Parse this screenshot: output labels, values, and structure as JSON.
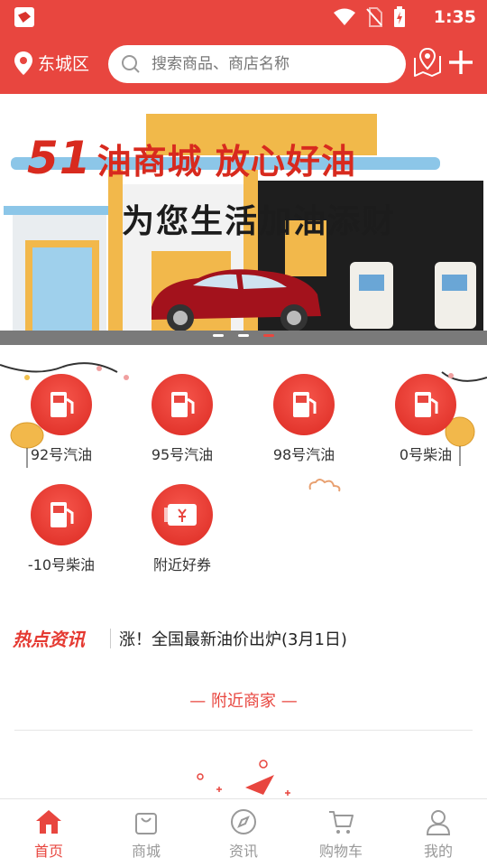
{
  "status_bar": {
    "time": "1:35"
  },
  "header": {
    "location": "东城区",
    "search_placeholder": "搜索商品、商店名称"
  },
  "banner": {
    "number": "51",
    "headline": "油商城 放心好油",
    "subline": "为您生活加油添财"
  },
  "categories": [
    {
      "label": "92号汽油",
      "icon": "fuel-pump-icon"
    },
    {
      "label": "95号汽油",
      "icon": "fuel-pump-icon"
    },
    {
      "label": "98号汽油",
      "icon": "fuel-pump-icon"
    },
    {
      "label": "0号柴油",
      "icon": "fuel-pump-icon"
    },
    {
      "label": "-10号柴油",
      "icon": "fuel-pump-icon"
    },
    {
      "label": "附近好券",
      "icon": "coupon-icon"
    }
  ],
  "news": {
    "title": "热点资讯",
    "headline": "涨！全国最新油价出炉(3月1日)"
  },
  "nearby": {
    "title": "— 附近商家 —"
  },
  "tabs": [
    {
      "label": "首页",
      "icon": "home-icon",
      "active": true
    },
    {
      "label": "商城",
      "icon": "shopping-bag-icon"
    },
    {
      "label": "资讯",
      "icon": "compass-icon"
    },
    {
      "label": "购物车",
      "icon": "cart-icon"
    },
    {
      "label": "我的",
      "icon": "user-icon"
    }
  ],
  "colors": {
    "brand": "#e8463f",
    "tab_inactive": "#999999"
  }
}
